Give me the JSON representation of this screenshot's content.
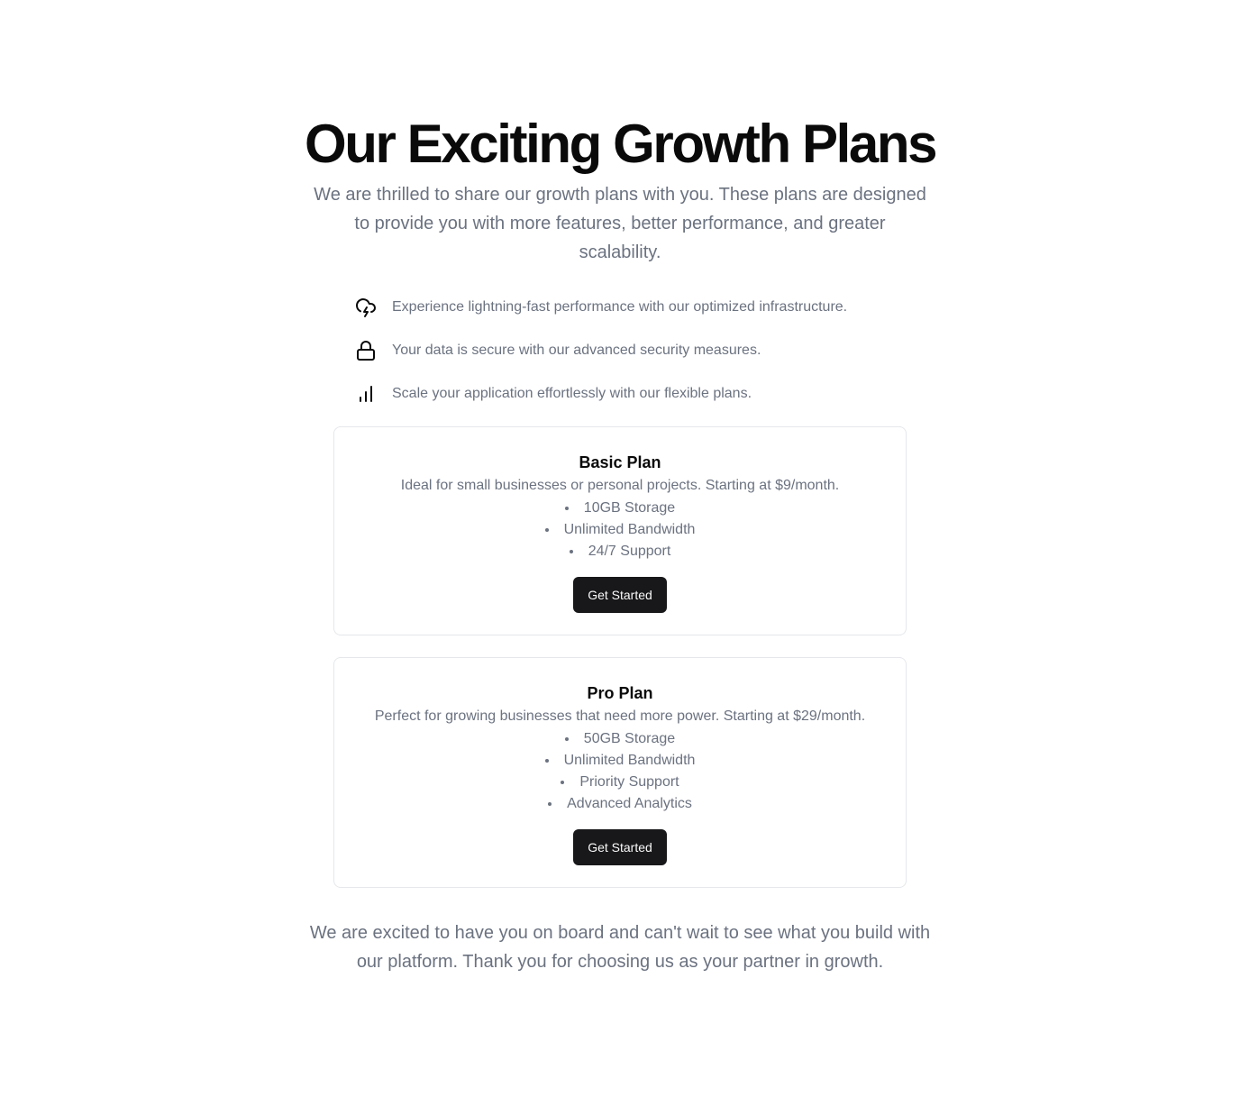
{
  "header": {
    "title": "Our Exciting Growth Plans",
    "subtitle": "We are thrilled to share our growth plans with you. These plans are designed to provide you with more features, better performance, and greater scalability."
  },
  "features": [
    {
      "icon": "cloud-lightning-icon",
      "text": "Experience lightning-fast performance with our optimized infrastructure."
    },
    {
      "icon": "lock-icon",
      "text": "Your data is secure with our advanced security measures."
    },
    {
      "icon": "bar-chart-icon",
      "text": "Scale your application effortlessly with our flexible plans."
    }
  ],
  "plans": [
    {
      "name": "Basic Plan",
      "description": "Ideal for small businesses or personal projects. Starting at $9/month.",
      "items": [
        "10GB Storage",
        "Unlimited Bandwidth",
        "24/7 Support"
      ],
      "button_label": "Get Started"
    },
    {
      "name": "Pro Plan",
      "description": "Perfect for growing businesses that need more power. Starting at $29/month.",
      "items": [
        "50GB Storage",
        "Unlimited Bandwidth",
        "Priority Support",
        "Advanced Analytics"
      ],
      "button_label": "Get Started"
    }
  ],
  "footer": {
    "closing": "We are excited to have you on board and can't wait to see what you build with our platform. Thank you for choosing us as your partner in growth."
  },
  "colors": {
    "heading": "#0a0a0a",
    "muted_text": "#6b7280",
    "button_bg": "#18181b",
    "button_text": "#fafafa",
    "card_border": "#e5e7eb"
  }
}
